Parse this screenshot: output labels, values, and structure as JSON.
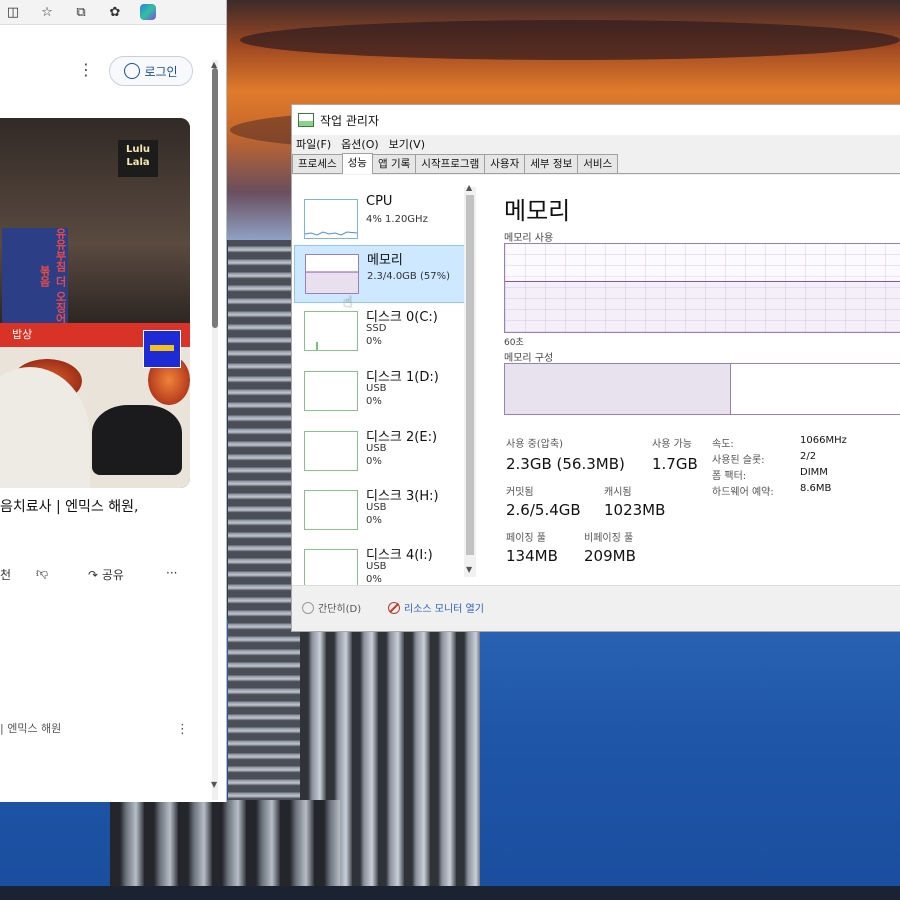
{
  "browser": {
    "login_label": "로그인",
    "thumbnail": {
      "logo_text": "Lulu Lala",
      "sign_text": "유유부침 더 오징어볶음",
      "banner_text": "밥상"
    },
    "video_title": "음치료사 | 엔믹스 해원,",
    "actions": {
      "like_partial": "천",
      "share_label": "공유",
      "more": "···"
    },
    "channel_text": "| 엔믹스 해원"
  },
  "taskmanager": {
    "title": "작업 관리자",
    "menu": [
      "파일(F)",
      "옵션(O)",
      "보기(V)"
    ],
    "tabs": [
      "프로세스",
      "성능",
      "앱 기록",
      "시작프로그램",
      "사용자",
      "세부 정보",
      "서비스"
    ],
    "active_tab": "성능",
    "resources": [
      {
        "name": "CPU",
        "sub1": "4% 1.20GHz",
        "sub2": ""
      },
      {
        "name": "메모리",
        "sub1": "2.3/4.0GB (57%)",
        "sub2": ""
      },
      {
        "name": "디스크 0(C:)",
        "sub1": "SSD",
        "sub2": "0%"
      },
      {
        "name": "디스크 1(D:)",
        "sub1": "USB",
        "sub2": "0%"
      },
      {
        "name": "디스크 2(E:)",
        "sub1": "USB",
        "sub2": "0%"
      },
      {
        "name": "디스크 3(H:)",
        "sub1": "USB",
        "sub2": "0%"
      },
      {
        "name": "디스크 4(I:)",
        "sub1": "USB",
        "sub2": "0%"
      }
    ],
    "selected_resource": "메모리",
    "memory_used_fraction": 0.563,
    "detail": {
      "heading": "메모리",
      "usage_label": "메모리 사용",
      "time_label": "60초",
      "composition_label": "메모리 구성",
      "stats": [
        {
          "label": "사용 중(압축)",
          "value": "2.3GB (56.3MB)"
        },
        {
          "label": "사용 가능",
          "value": "1.7GB"
        },
        {
          "label": "커밋됨",
          "value": "2.6/5.4GB"
        },
        {
          "label": "캐시됨",
          "value": "1023MB"
        },
        {
          "label": "페이징 풀",
          "value": "134MB"
        },
        {
          "label": "비페이징 풀",
          "value": "209MB"
        }
      ],
      "side": [
        {
          "label": "속도:",
          "value": "1066MHz"
        },
        {
          "label": "사용된 슬롯:",
          "value": "2/2"
        },
        {
          "label": "폼 팩터:",
          "value": "DIMM"
        },
        {
          "label": "하드웨어 예약:",
          "value": "8.6MB"
        }
      ]
    },
    "footer": {
      "brief_label": "간단히(D)",
      "monitor_label": "리소스 모니터 열기"
    }
  }
}
